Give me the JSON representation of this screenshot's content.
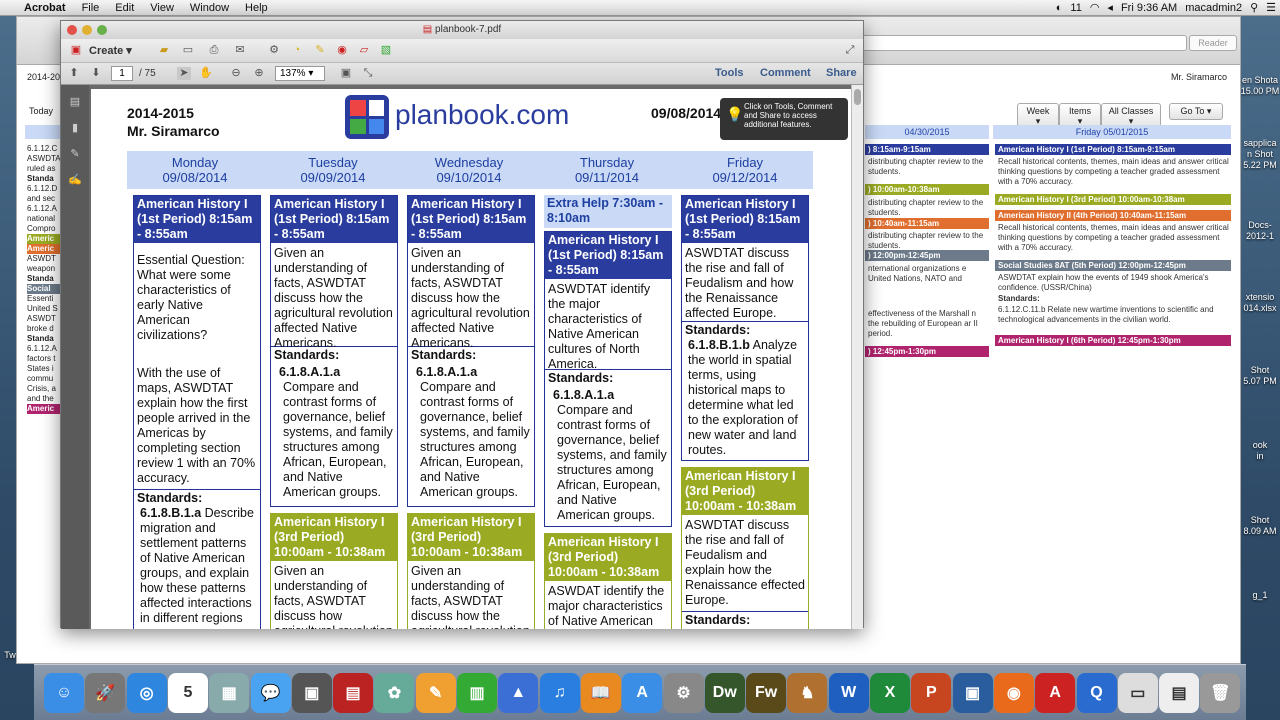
{
  "menubar": {
    "apple": "",
    "app": "Acrobat",
    "items": [
      "File",
      "Edit",
      "View",
      "Window",
      "Help"
    ],
    "status": [
      "11",
      "Fri 9:36 AM",
      "macadmin2"
    ]
  },
  "bg_browser": {
    "reader": "Reader",
    "date_prefix": "2014-20",
    "user": "Mr. Siramarco",
    "today": "Today",
    "buttons": {
      "week": "Week",
      "items": "Items",
      "all_classes": "All Classes",
      "goto": "Go To"
    },
    "day_left": "04/30/2015",
    "day_right": "Friday 05/01/2015",
    "mid_events": [
      {
        "label": ") 8:15am-9:15am",
        "color": "#2a3d9e"
      },
      {
        "text": "distributing chapter review to the students."
      },
      {
        "label": ") 10:00am-10:38am",
        "color": "#9aab23"
      },
      {
        "text": "distributing chapter review to the students."
      },
      {
        "label": ") 10:40am-11:15am",
        "color": "#e06e2e"
      },
      {
        "text": "distributing chapter review to the students."
      },
      {
        "label": ") 12:00pm-12:45pm",
        "color": "#6c7a8a"
      },
      {
        "text": "nternational organizations e United Nations, NATO and"
      },
      {
        "text": "effectiveness of the Marshall n the rebuilding of European ar II period."
      },
      {
        "label": ") 12:45pm-1:30pm",
        "color": "#b0246e"
      }
    ],
    "right_events": [
      {
        "label": "American History I (1st Period) 8:15am-9:15am",
        "color": "#2a3d9e"
      },
      {
        "text": "Recall historical contents, themes, main ideas and answer critical thinking questions by competing a teacher graded assessment with a 70% accuracy."
      },
      {
        "label": "American History I (3rd Period) 10:00am-10:38am",
        "color": "#9aab23"
      },
      {
        "label": "American History II (4th Period) 10:40am-11:15am",
        "color": "#e06e2e"
      },
      {
        "text": "Recall historical contents, themes, main ideas and answer critical thinking questions by competing a teacher graded assessment with a 70% accuracy."
      },
      {
        "label": "Social Studies 8AT (5th Period) 12:00pm-12:45pm",
        "color": "#6c7a8a"
      },
      {
        "text": "ASWDTAT explain how the events of 1949 shook America's confidence. (USSR/China)"
      },
      {
        "text": "Standards:"
      },
      {
        "text": "6.1.12.C.11.b Relate new wartime inventions to scientific and technological advancements in the civilian world."
      },
      {
        "label": "American History I (6th Period) 12:45pm-1:30pm",
        "color": "#b0246e"
      }
    ],
    "left_strip": [
      "6.1.12.C",
      "ASWDTAT",
      "ruled as",
      "Standa",
      "6.1.12.D",
      "and sec",
      "6.1.12.A",
      "national",
      "Compro",
      "Americ",
      "Americ",
      "ASWDT",
      "weapon",
      "Standa",
      "Social",
      "Essenti",
      "United S",
      "ASWDT",
      "broke d",
      "Standa",
      "6.1.12.A",
      "factors t",
      "States i",
      "commu",
      "Crisis, a",
      "and the",
      "Americ"
    ]
  },
  "desktop_labels": [
    "en Shota",
    "15.00 PM",
    "sapplica",
    "n Shot",
    "5.22 PM",
    "Docs-",
    "2012-1",
    "xtensio",
    "014.xlsx",
    "Shot",
    "5.07 PM",
    "ook",
    "in",
    "Shot",
    "8.09 AM",
    "g_1",
    "Tw"
  ],
  "acrobat": {
    "title": "planbook-7.pdf",
    "create": "Create",
    "page_current": "1",
    "page_total": "/ 75",
    "zoom": "137%",
    "tools": "Tools",
    "comment": "Comment",
    "share": "Share",
    "tooltip": "Click on Tools, Comment and Share to access additional features."
  },
  "planbook": {
    "year": "2014-2015",
    "teacher": "Mr. Siramarco",
    "logo": "planbook.com",
    "week_date": "09/08/2014",
    "days": [
      {
        "name": "Monday",
        "date": "09/08/2014"
      },
      {
        "name": "Tuesday",
        "date": "09/09/2014"
      },
      {
        "name": "Wednesday",
        "date": "09/10/2014"
      },
      {
        "name": "Thursday",
        "date": "09/11/2014"
      },
      {
        "name": "Friday",
        "date": "09/12/2014"
      }
    ],
    "mon": {
      "header": "American History I (1st Period) 8:15am - 8:55am",
      "body1": "Essential Question: What were some characteristics of early Native American civilizations?",
      "body2": "With the use of maps, ASWDTAT explain how the first people arrived in the Americas by completing section review 1 with an 70% accuracy.",
      "standards": "Standards:",
      "code": "6.1.8.B.1.a",
      "desc": "Describe migration and settlement patterns of Native American groups, and explain how these patterns affected interactions in different regions"
    },
    "tue": {
      "header": "American History I (1st Period) 8:15am - 8:55am",
      "body": "Given an understanding of facts, ASWDTAT discuss how the agricultural revolution affected Native Americans.",
      "standards": "Standards:",
      "code": "6.1.8.A.1.a",
      "desc": "Compare and contrast forms of governance, belief systems, and family structures among African, European, and Native American groups.",
      "header2": "American History I (3rd Period) 10:00am - 10:38am",
      "body2": "Given an understanding of facts, ASWDTAT discuss how agricultural revolution"
    },
    "wed": {
      "header": "American History I (1st Period) 8:15am - 8:55am",
      "body": "Given an understanding of facts, ASWDTAT discuss how the agricultural revolution affected Native Americans.",
      "standards": "Standards:",
      "code": "6.1.8.A.1.a",
      "desc": "Compare and contrast forms of governance, belief systems, and family structures among African, European, and Native American groups.",
      "header2": "American History I (3rd Period) 10:00am - 10:38am",
      "body2": "Given an understanding of facts, ASWDTAT discuss how the agricultural revolution"
    },
    "thu": {
      "extra": "Extra Help 7:30am - 8:10am",
      "header": "American History I (1st Period) 8:15am - 8:55am",
      "body": "ASWDTAT identify the major characteristics of Native American cultures of North America.",
      "standards": "Standards:",
      "code": "6.1.8.A.1.a",
      "desc": "Compare and contrast forms of governance, belief systems, and family structures among African, European, and Native American groups.",
      "header2": "American History I (3rd Period) 10:00am - 10:38am",
      "body2": "ASWDAT identify the major characteristics of Native American"
    },
    "fri": {
      "header": "American History I (1st Period) 8:15am - 8:55am",
      "body": "ASWDTAT discuss the rise and fall of Feudalism and how the Renaissance affected Europe.",
      "standards": "Standards:",
      "code": "6.1.8.B.1.b",
      "desc": "Analyze the world in spatial terms, using historical maps to determine what led to the exploration of new water and land routes.",
      "header2": "American History I (3rd Period) 10:00am - 10:38am",
      "body2": "ASWDTAT discuss the rise and fall of Feudalism and explain how the Renaissance effected Europe.",
      "standards2": "Standards:"
    }
  },
  "dock": [
    {
      "name": "finder",
      "color": "#3a8ee6",
      "glyph": "☺"
    },
    {
      "name": "launchpad",
      "color": "#777",
      "glyph": "🚀"
    },
    {
      "name": "safari",
      "color": "#2e86de",
      "glyph": "◎"
    },
    {
      "name": "calendar",
      "color": "#fff",
      "glyph": "5"
    },
    {
      "name": "preview",
      "color": "#8aa",
      "glyph": "▦"
    },
    {
      "name": "messages",
      "color": "#4aa3f0",
      "glyph": "💬"
    },
    {
      "name": "facetime",
      "color": "#555",
      "glyph": "▣"
    },
    {
      "name": "photo-booth",
      "color": "#b22",
      "glyph": "▤"
    },
    {
      "name": "iphoto",
      "color": "#6a9",
      "glyph": "✿"
    },
    {
      "name": "pages",
      "color": "#f0a030",
      "glyph": "✎"
    },
    {
      "name": "numbers",
      "color": "#3a3",
      "glyph": "▥"
    },
    {
      "name": "keynote",
      "color": "#3b6fd6",
      "glyph": "▲"
    },
    {
      "name": "itunes",
      "color": "#2a7ee0",
      "glyph": "♫"
    },
    {
      "name": "ibooks",
      "color": "#e88a20",
      "glyph": "📖"
    },
    {
      "name": "app-store",
      "color": "#3a8ee6",
      "glyph": "A"
    },
    {
      "name": "system-preferences",
      "color": "#888",
      "glyph": "⚙"
    },
    {
      "name": "dreamweaver",
      "color": "#35562a",
      "glyph": "Dw"
    },
    {
      "name": "fireworks",
      "color": "#5a4a1a",
      "glyph": "Fw"
    },
    {
      "name": "sandvox",
      "color": "#b07030",
      "glyph": "♞"
    },
    {
      "name": "word",
      "color": "#1f5fbf",
      "glyph": "W"
    },
    {
      "name": "excel",
      "color": "#1f8a3a",
      "glyph": "X"
    },
    {
      "name": "powerpoint",
      "color": "#c8461f",
      "glyph": "P"
    },
    {
      "name": "microsoft-remote",
      "color": "#2a5d9e",
      "glyph": "▣"
    },
    {
      "name": "firefox",
      "color": "#e86a1a",
      "glyph": "◉"
    },
    {
      "name": "acrobat",
      "color": "#c22",
      "glyph": "A"
    },
    {
      "name": "quicktime",
      "color": "#2a6bd0",
      "glyph": "Q"
    },
    {
      "name": "document-stack",
      "color": "#ddd",
      "glyph": "▭"
    },
    {
      "name": "document",
      "color": "#eee",
      "glyph": "▤"
    },
    {
      "name": "trash",
      "color": "#999",
      "glyph": "🗑"
    }
  ]
}
